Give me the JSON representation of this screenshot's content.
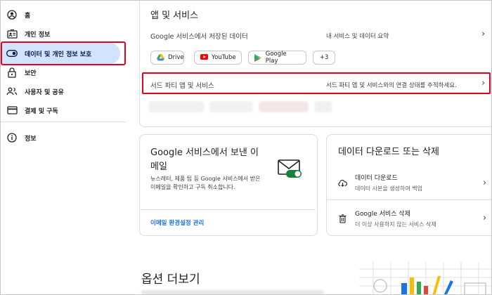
{
  "sidebar": {
    "items": [
      {
        "label": "홈",
        "icon": "home-account-icon"
      },
      {
        "label": "개인 정보",
        "icon": "id-card-icon"
      },
      {
        "label": "데이터 및 개인 정보 보호",
        "icon": "toggle-icon"
      },
      {
        "label": "보안",
        "icon": "lock-icon"
      },
      {
        "label": "사용자 및 공유",
        "icon": "people-icon"
      },
      {
        "label": "결제 및 구독",
        "icon": "credit-card-icon"
      },
      {
        "label": "정보",
        "icon": "info-icon"
      }
    ]
  },
  "apps": {
    "title": "앱 및 서비스",
    "stored_label": "Google 서비스에서 저장된 데이터",
    "stored_desc": "내 서비스 및 데이터 요약",
    "chips": [
      "Drive",
      "YouTube",
      "Google Play",
      "+3"
    ],
    "third_party_label": "서드 파티 앱 및 서비스",
    "third_party_desc": "서드 파티 앱 및 서비스와의 연결 상태를 추적하세요."
  },
  "email_card": {
    "title_line1": "Google 서비스에서 보낸 이",
    "title_line2": "메일",
    "desc_line1": "뉴스레터, 제품 팁 등 Google 서비스에서 받은",
    "desc_line2": "이메일을 확인하고 구독 취소합니다.",
    "link": "이메일 환경설정 관리"
  },
  "download_card": {
    "title": "데이터 다운로드 또는 삭제",
    "download_title": "데이터 다운로드",
    "download_sub": "데이터 사본을 생성하여 백업",
    "delete_title": "Google 서비스 삭제",
    "delete_sub": "더 이상 사용하지 않는 서비스 삭제"
  },
  "more": {
    "title": "옵션 더보기"
  },
  "colors": {
    "active_bg": "#d3e3fd",
    "highlight_red": "#e3001b",
    "link_blue": "#1a73e8",
    "toggle_green": "#188038"
  }
}
